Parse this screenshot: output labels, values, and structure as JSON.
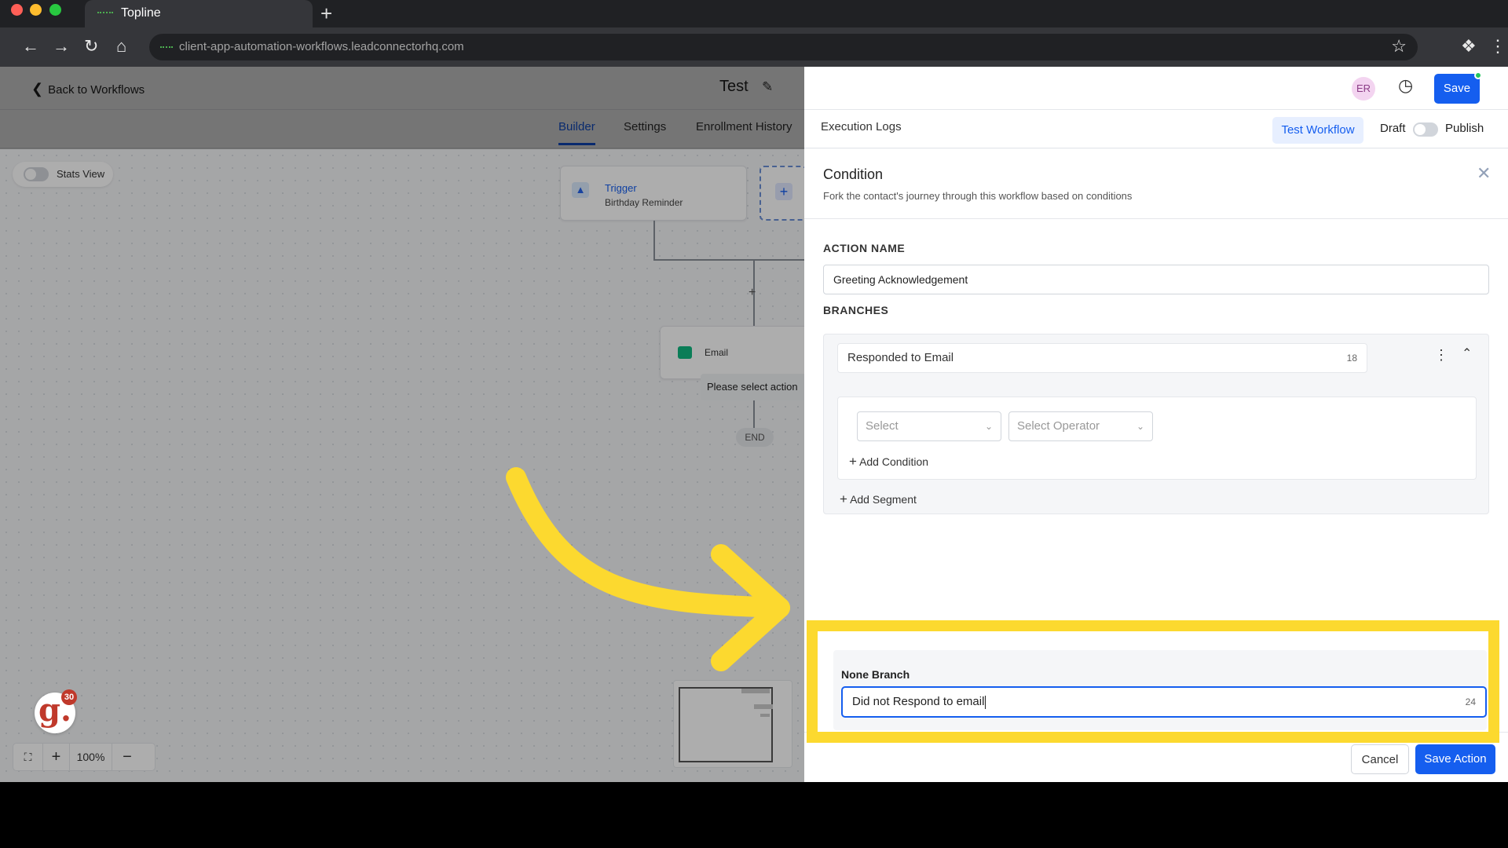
{
  "browser": {
    "tab_title": "Topline",
    "new_tab": "+",
    "url": "client-app-automation-workflows.leadconnectorhq.com"
  },
  "header": {
    "back_label": "Back to Workflows",
    "workflow_title": "Test",
    "avatar_initials": "ER",
    "save_label": "Save"
  },
  "nav_tabs": [
    "Builder",
    "Settings",
    "Enrollment History",
    "Execution Logs"
  ],
  "toolbar": {
    "test_workflow": "Test Workflow",
    "draft": "Draft",
    "publish": "Publish"
  },
  "canvas": {
    "stats_view": "Stats View",
    "trigger_title": "Trigger",
    "trigger_subtitle": "Birthday Reminder",
    "email_node": "Email",
    "tooltip": "Please select action",
    "end": "END",
    "zoom": "100%"
  },
  "badge_count": "30",
  "panel": {
    "title": "Condition",
    "subtitle": "Fork the contact's journey through this workflow based on conditions",
    "action_name_label": "ACTION NAME",
    "action_name_value": "Greeting Acknowledgement",
    "branches_label": "BRANCHES",
    "branch_name": "Responded to Email",
    "branch_count": "18",
    "select_placeholder": "Select",
    "operator_placeholder": "Select Operator",
    "add_condition": "Add Condition",
    "add_segment": "Add Segment",
    "none_branch_label": "None Branch",
    "none_branch_value": "Did not Respond to email",
    "none_branch_count": "24",
    "cancel": "Cancel",
    "save_action": "Save Action"
  },
  "colors": {
    "accent": "#155eef",
    "highlight": "#fcd92f",
    "success": "#22c55e"
  }
}
